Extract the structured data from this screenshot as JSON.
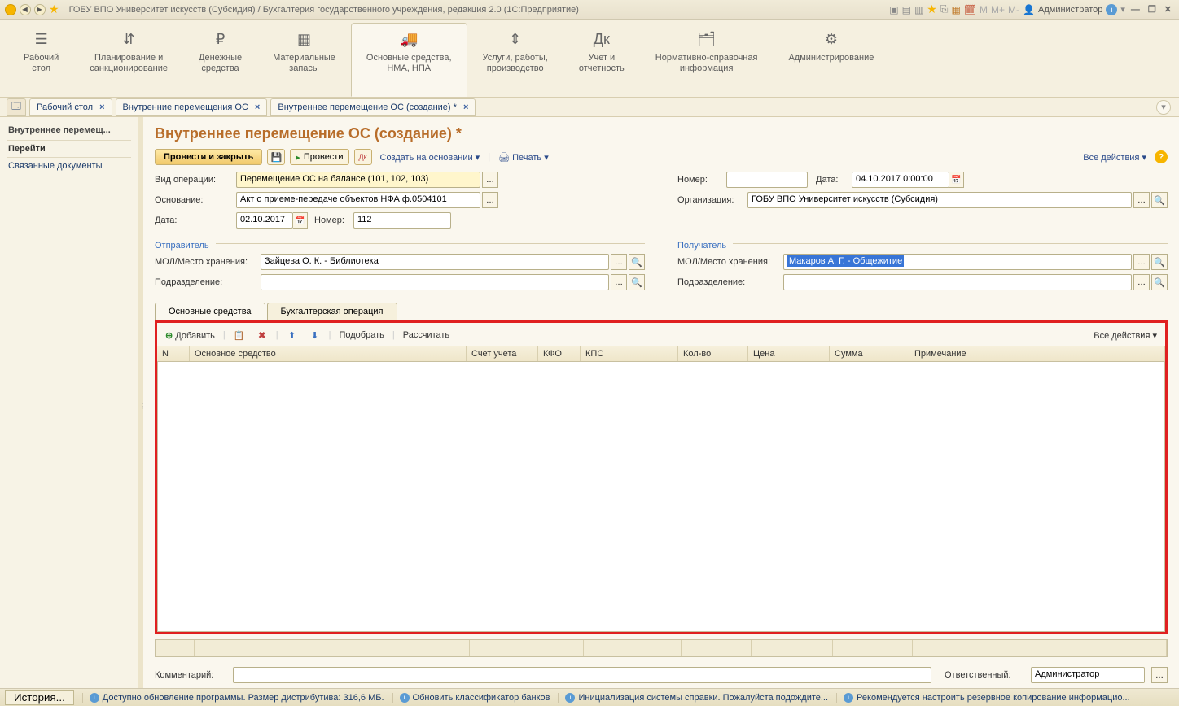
{
  "titlebar": {
    "title": "ГОБУ ВПО Университет искусств (Субсидия) / Бухгалтерия государственного учреждения, редакция 2.0  (1С:Предприятие)",
    "user_label": "Администратор",
    "m": "M",
    "mplus": "M+",
    "mminus": "M-"
  },
  "sections": [
    {
      "label": "Рабочий\nстол",
      "icon": "☰"
    },
    {
      "label": "Планирование и\nсанкционирование",
      "icon": "⇵"
    },
    {
      "label": "Денежные\nсредства",
      "icon": "₽"
    },
    {
      "label": "Материальные\nзапасы",
      "icon": "▦"
    },
    {
      "label": "Основные средства,\nНМА, НПА",
      "icon": "🚚",
      "active": true
    },
    {
      "label": "Услуги, работы,\nпроизводство",
      "icon": "⇕"
    },
    {
      "label": "Учет и\nотчетность",
      "icon": "Дк"
    },
    {
      "label": "Нормативно-справочная\nинформация",
      "icon": "🗂"
    },
    {
      "label": "Администрирование",
      "icon": "⚙"
    }
  ],
  "tabs": [
    {
      "label": "Рабочий стол",
      "close": true
    },
    {
      "label": "Внутренние перемещения ОС",
      "close": true
    },
    {
      "label": "Внутреннее перемещение ОС (создание) *",
      "close": true
    }
  ],
  "sidebar": {
    "head": "Внутреннее перемещ...",
    "links": [
      "Перейти",
      "Связанные документы"
    ]
  },
  "page": {
    "title": "Внутреннее перемещение ОС (создание) *",
    "post_close": "Провести и закрыть",
    "post": "Провести",
    "create_based": "Создать на основании",
    "print": "Печать",
    "all_actions": "Все действия",
    "fields": {
      "op_kind_l": "Вид операции:",
      "op_kind": "Перемещение ОС на балансе (101, 102, 103)",
      "basis_l": "Основание:",
      "basis": "Акт о приеме-передаче объектов НФА ф.0504101",
      "date_src_l": "Дата:",
      "date_src": "02.10.2017",
      "number_src_l": "Номер:",
      "number_src": "112",
      "doc_number_l": "Номер:",
      "doc_number": "",
      "doc_date_l": "Дата:",
      "doc_date": "04.10.2017 0:00:00",
      "org_l": "Организация:",
      "org": "ГОБУ ВПО Университет искусств (Субсидия)"
    },
    "sender": {
      "title": "Отправитель",
      "mol_l": "МОЛ/Место хранения:",
      "mol": "Зайцева О. К. - Библиотека",
      "dept_l": "Подразделение:",
      "dept": ""
    },
    "receiver": {
      "title": "Получатель",
      "mol_l": "МОЛ/Место хранения:",
      "mol": "Макаров А. Г. - Общежитие",
      "dept_l": "Подразделение:",
      "dept": ""
    },
    "subtabs": [
      "Основные средства",
      "Бухгалтерская операция"
    ],
    "tabletools": {
      "add": "Добавить",
      "pick": "Подобрать",
      "calc": "Рассчитать",
      "all": "Все действия"
    },
    "grid": {
      "cols": [
        "N",
        "Основное средство",
        "Счет учета",
        "КФО",
        "КПС",
        "Кол-во",
        "Цена",
        "Сумма",
        "Примечание"
      ]
    },
    "comment_l": "Комментарий:",
    "comment": "",
    "resp_l": "Ответственный:",
    "resp": "Администратор"
  },
  "statusbar": {
    "history": "История...",
    "items": [
      "Доступно обновление программы. Размер дистрибутива: 316,6 МБ.",
      "Обновить классификатор банков",
      "Инициализация системы справки. Пожалуйста подождите...",
      "Рекомендуется настроить резервное копирование информацио..."
    ]
  }
}
